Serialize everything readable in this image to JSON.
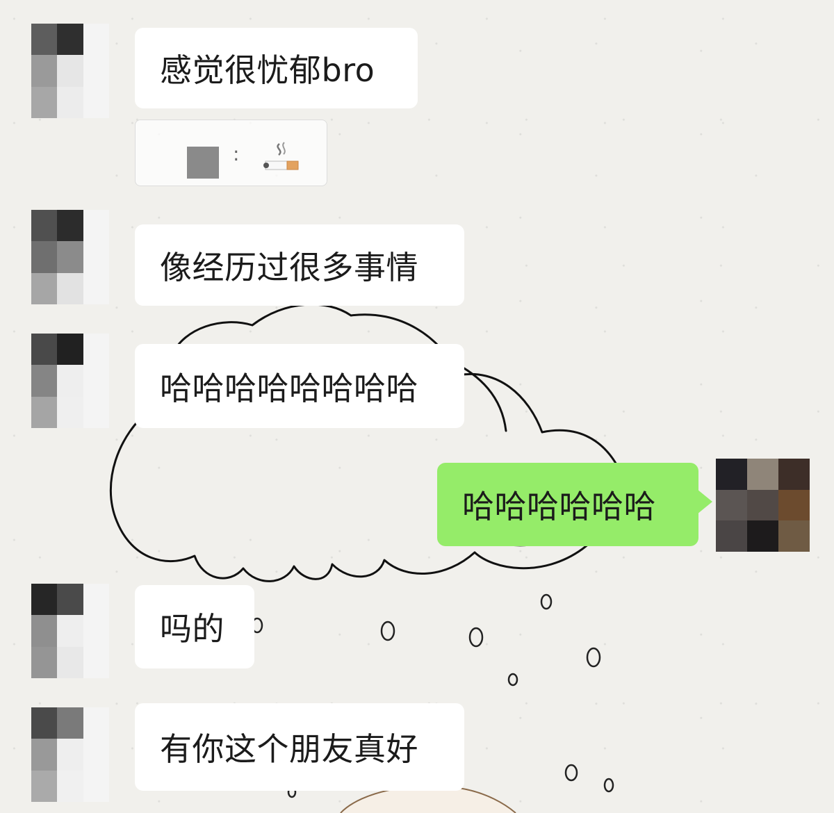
{
  "messages": [
    {
      "sender": "other",
      "text": "感觉很忧郁bro"
    },
    {
      "sender": "other",
      "text": "像经历过很多事情"
    },
    {
      "sender": "other",
      "text": "哈哈哈哈哈哈哈哈"
    },
    {
      "sender": "me",
      "text": "哈哈哈哈哈哈"
    },
    {
      "sender": "other",
      "text": "吗的"
    },
    {
      "sender": "other",
      "text": "有你这个朋友真好"
    }
  ],
  "quote": {
    "separator": ":",
    "icon": "cigarette-icon"
  },
  "colors": {
    "background": "#f1f0ec",
    "bubble_other": "#ffffff",
    "bubble_me": "#95ec69"
  }
}
